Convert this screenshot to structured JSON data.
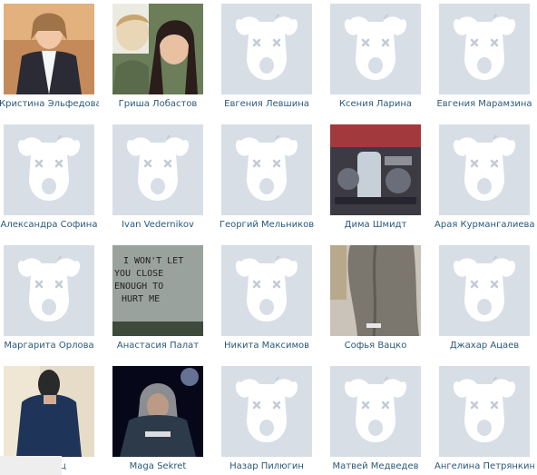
{
  "friends": [
    {
      "name": "Кристина Эльфедова",
      "photo": "photo-girl-white-shirt"
    },
    {
      "name": "Гриша Лобастов",
      "photo": "photo-couple-selfie"
    },
    {
      "name": "Евгения Левшина",
      "photo": "deactivated-dog-icon"
    },
    {
      "name": "Ксения Ларина",
      "photo": "deactivated-dog-icon"
    },
    {
      "name": "Евгения Марамзина",
      "photo": "deactivated-dog-icon"
    },
    {
      "name": "Александра Софина",
      "photo": "deactivated-dog-icon"
    },
    {
      "name": "Ivan Vedernikov",
      "photo": "deactivated-dog-icon"
    },
    {
      "name": "Георгий Мельников",
      "photo": "deactivated-dog-icon"
    },
    {
      "name": "Дима Шмидт",
      "photo": "photo-engine-bay"
    },
    {
      "name": "Арая Курмангалиева",
      "photo": "deactivated-dog-icon"
    },
    {
      "name": "Маргарита Орлова",
      "photo": "deactivated-dog-icon"
    },
    {
      "name": "Анастасия Палат",
      "photo": "photo-handwritten-note",
      "photo_text": [
        "I WON'T LET",
        "YOU CLOSE",
        "ENOUGH TO",
        "HURT ME"
      ]
    },
    {
      "name": "Никита Максимов",
      "photo": "deactivated-dog-icon"
    },
    {
      "name": "Софья Вацко",
      "photo": "photo-tree-trunk"
    },
    {
      "name": "Джахар Ацаев",
      "photo": "deactivated-dog-icon"
    },
    {
      "name": "дковец",
      "photo": "photo-guy-blue-jacket"
    },
    {
      "name": "Maga Sekret",
      "photo": "photo-hooded-guy-night"
    },
    {
      "name": "Назар Пилюгин",
      "photo": "deactivated-dog-icon"
    },
    {
      "name": "Матвей Медведев",
      "photo": "deactivated-dog-icon"
    },
    {
      "name": "Ангелина Петрянкина",
      "photo": "deactivated-dog-icon"
    }
  ],
  "colors": {
    "link": "#2b587a",
    "placeholder_bg": "#d8dee6",
    "placeholder_fg": "#ffffff",
    "placeholder_eyes": "#c2cbd6"
  }
}
